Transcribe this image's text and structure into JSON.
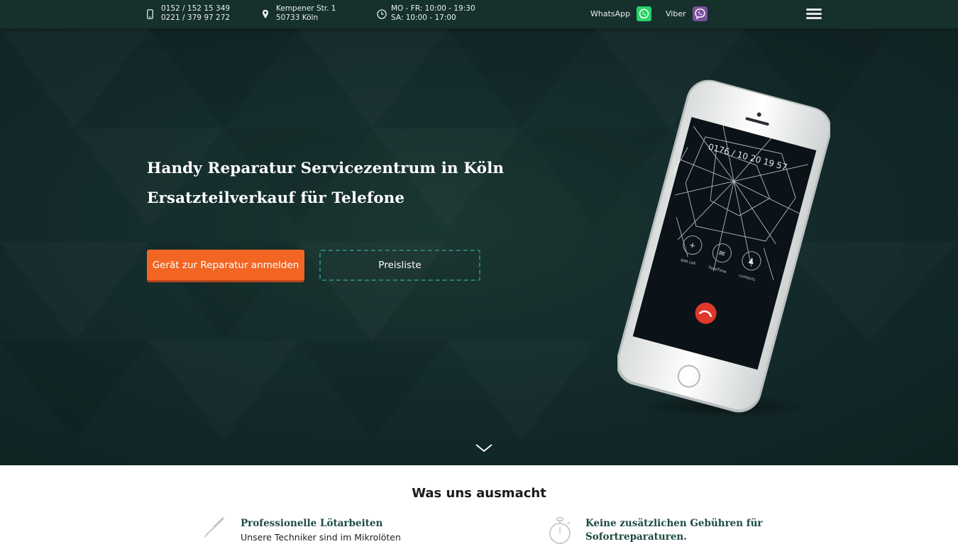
{
  "topbar": {
    "phone_1": "0152 / 152 15 349",
    "phone_2": "0221 / 379 97 272",
    "address_1": "Kempener Str. 1",
    "address_2": "50733 Köln",
    "hours_1": "MO - FR: 10:00 - 19:30",
    "hours_2": "SA: 10:00 - 17:00",
    "whatsapp_label": "WhatsApp",
    "viber_label": "Viber",
    "icons": [
      "phone-icon",
      "location-pin-icon",
      "clock-icon",
      "whatsapp-icon",
      "viber-icon",
      "hamburger-menu-icon"
    ]
  },
  "hero": {
    "title_line_1": "Handy Reparatur Servicezentrum in Köln",
    "title_line_2": "Ersatzteilverkauf für Telefone",
    "primary_button": "Gerät zur Reparatur anmelden",
    "secondary_button": "Preisliste",
    "phone_screen_number": "0176 / 10 20 19 57",
    "phone_call_labels": [
      "+",
      "✉",
      "♟"
    ],
    "phone_call_captions": [
      "add call",
      "FaceTime",
      "contacts"
    ],
    "scroll_icon": "chevron-down-icon"
  },
  "features": {
    "title": "Was uns ausmacht",
    "items": [
      {
        "title": "Professionelle Lötarbeiten",
        "description": "Unsere Techniker sind im Mikrolöten",
        "icon": "soldering-iron-icon"
      },
      {
        "title_line_1": "Keine zusätzlichen Gebühren für",
        "title_line_2": "Sofortreparaturen.",
        "icon": "stopwatch-icon"
      }
    ]
  },
  "colors": {
    "topbar_bg": "#16302c",
    "hero_bg": "#13292a",
    "accent_orange": "#f26522",
    "outline_green": "#2e7d6b",
    "feature_title": "#1d4a44",
    "whatsapp_green": "#25d366",
    "viber_purple": "#7b519d"
  }
}
